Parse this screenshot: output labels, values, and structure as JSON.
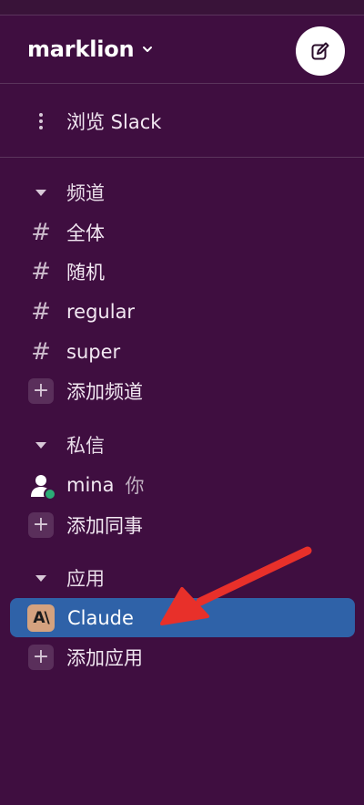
{
  "workspace": {
    "name": "marklion"
  },
  "nav": {
    "browse_label": "浏览 Slack"
  },
  "channels": {
    "section_title": "频道",
    "items": [
      {
        "name": "全体"
      },
      {
        "name": "随机"
      },
      {
        "name": "regular"
      },
      {
        "name": "super"
      }
    ],
    "add_label": "添加频道"
  },
  "dms": {
    "section_title": "私信",
    "items": [
      {
        "name": "mina",
        "tag": "你"
      }
    ],
    "add_label": "添加同事"
  },
  "apps": {
    "section_title": "应用",
    "items": [
      {
        "name": "Claude",
        "avatar_text": "A\\"
      }
    ],
    "add_label": "添加应用"
  },
  "colors": {
    "sidebar_bg": "#3f0e40",
    "active_bg": "#2f62a8",
    "annotation_arrow": "#e8302a",
    "presence": "#2bac76"
  },
  "icons": {
    "compose": "compose-icon",
    "chevron": "chevron-down-icon",
    "more": "vertical-dots-icon",
    "channel": "hash-icon",
    "add": "plus-icon",
    "collapse": "caret-down-icon",
    "user": "user-avatar-icon"
  }
}
